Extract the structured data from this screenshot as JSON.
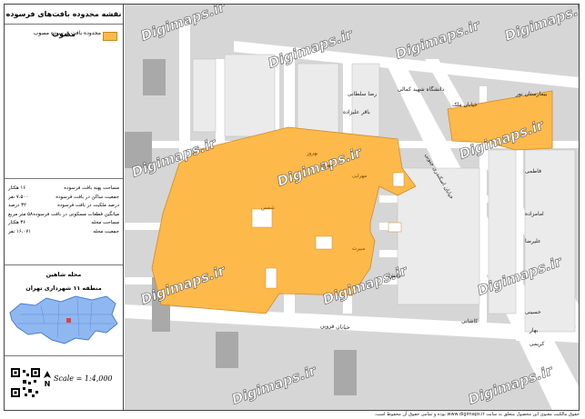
{
  "sidebar": {
    "title": "نقشه محدوده بافت‌های فرسوده مصوب",
    "legend": {
      "label": "محدوده بافت فرسوده مصوب",
      "color": "#fdb94a"
    },
    "stats": [
      {
        "label": "مساحت پهنه بافت فرسوده",
        "value": "۱۶ هکتار"
      },
      {
        "label": "جمعیت ساکن در بافت فرسوده",
        "value": "۷،۵۰۰ نفر"
      },
      {
        "label": "درصد ملکیت در بافت فرسوده",
        "value": "۳۲ درصد"
      },
      {
        "label": "میانگین قطعات مسکونی در بافت فرسوده",
        "value": "۵۸ متر مربع"
      },
      {
        "label": "مساحت محله",
        "value": "۳۶ هکتار"
      },
      {
        "label": "جمعیت محله",
        "value": "۱۶،۰۷۱ نفر"
      }
    ],
    "location": {
      "line1": "محله شاهین",
      "line2": "منطقه ۱۱ شهرداری تهران"
    },
    "scale": "Scale = 1:4,000",
    "north": "N"
  },
  "map": {
    "watermark": "Digimaps.ir",
    "labels": [
      "دانشگاه شهید کمالی",
      "رضا سلطانی",
      "بیمارستان نور",
      "خیابان ملک",
      "باقر علیزاده",
      "بهروز",
      "مهران",
      "مهرابی",
      "شمس",
      "سیرت",
      "خیابان اسکندری جنوبی",
      "فاطمی",
      "امامزاده",
      "علیرضا",
      "خیابان قزوین",
      "دانش",
      "حسینی",
      "کاشانی",
      "بهار",
      "کریمی"
    ],
    "street_main": "خیابان قزوین"
  },
  "footer": "حقوق مالکیت معنوی این محصول متعلق به سایت www.digimaps.ir بوده و تمامی حقوق آن محفوظ است."
}
